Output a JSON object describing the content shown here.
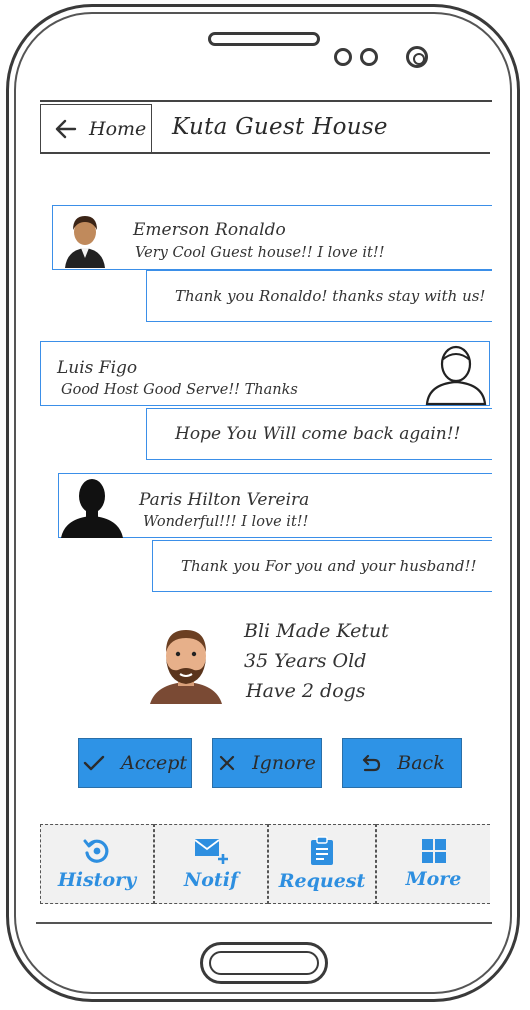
{
  "header": {
    "back_label": "Home",
    "title": "Kuta Guest House"
  },
  "reviews": [
    {
      "name": "Emerson Ronaldo",
      "comment": "Very Cool Guest house!! I love it!!",
      "reply": "Thank you Ronaldo! thanks stay with us!"
    },
    {
      "name": "Luis Figo",
      "comment": "Good Host Good Serve!! Thanks",
      "reply": "Hope You Will come back again!!"
    },
    {
      "name": "Paris Hilton Vereira",
      "comment": "Wonderful!!! I love it!!",
      "reply": "Thank you For you and your husband!!"
    }
  ],
  "profile": {
    "name": "Bli Made Ketut",
    "age": "35 Years Old",
    "note": "Have 2 dogs"
  },
  "actions": {
    "accept": "Accept",
    "ignore": "Ignore",
    "back": "Back"
  },
  "tabs": [
    {
      "label": "History",
      "icon": "history-icon"
    },
    {
      "label": "Notif",
      "icon": "mail-plus-icon"
    },
    {
      "label": "Request",
      "icon": "clipboard-icon"
    },
    {
      "label": "More",
      "icon": "grid-icon"
    }
  ],
  "colors": {
    "accent": "#2e93e6",
    "card_border": "#3b8fe8"
  }
}
